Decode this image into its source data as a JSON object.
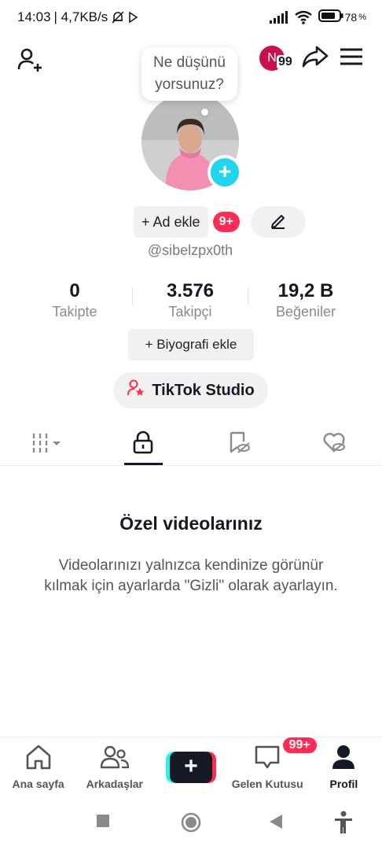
{
  "status_bar": {
    "time": "14:03",
    "speed": "| 4,7KB/s",
    "battery": "78"
  },
  "bubble": {
    "line1": "Ne düşünü",
    "line2": "yorsunuz?"
  },
  "header": {
    "n_initial": "N",
    "n_count": "99"
  },
  "profile": {
    "add_name_label": "+ Ad ekle",
    "notif_badge": "9+",
    "username": "@sibelzpx0th"
  },
  "stats": [
    {
      "value": "0",
      "label": "Takipte"
    },
    {
      "value": "3.576",
      "label": "Takipçi"
    },
    {
      "value": "19,2 B",
      "label": "Beğeniler"
    }
  ],
  "bio_button": "+ Biyografi ekle",
  "studio_button": "TikTok Studio",
  "empty_state": {
    "title": "Özel videolarınız",
    "description": "Videolarınızı yalnızca kendinize görünür kılmak için ayarlarda \"Gizli\" olarak ayarlayın."
  },
  "bottom_nav": {
    "home": "Ana sayfa",
    "friends": "Arkadaşlar",
    "inbox": "Gelen Kutusu",
    "inbox_badge": "99+",
    "profile": "Profil"
  },
  "colors": {
    "accent_red": "#fe2c55",
    "accent_cyan": "#25f4ee",
    "add_avatar": "#20d5ec",
    "text_primary": "#161823"
  }
}
